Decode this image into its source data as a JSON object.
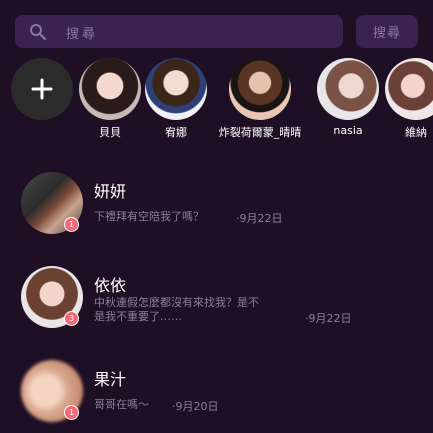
{
  "search": {
    "placeholder": "搜尋",
    "button_label": "搜尋"
  },
  "stories": [
    {
      "name": "貝貝"
    },
    {
      "name": "宥娜"
    },
    {
      "name": "炸裂荷爾蒙_晴晴"
    },
    {
      "name": "nasia"
    },
    {
      "name": "維納"
    }
  ],
  "chats": [
    {
      "name": "妍妍",
      "preview": "下禮拜有空陪我了嗎？",
      "time": "·9月22日",
      "unread": "1"
    },
    {
      "name": "依依",
      "preview_line1": "中秋連假怎麼都沒有來找我？是不",
      "preview_line2": "是我不重要了……",
      "time": "·9月22日",
      "unread": "3"
    },
    {
      "name": "果汁",
      "preview": "哥哥在嗎～",
      "time": "·9月20日",
      "unread": "1"
    }
  ],
  "colors": {
    "background": "#1e0f24",
    "search_bg": "#3a2350",
    "badge": "#f06b78"
  }
}
